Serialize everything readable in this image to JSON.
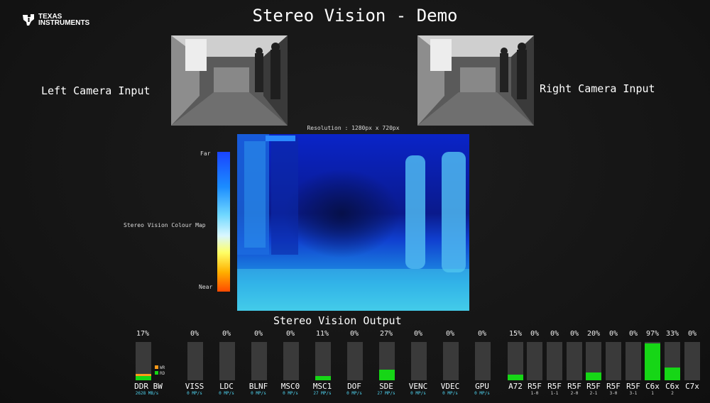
{
  "header": {
    "brand_line1": "TEXAS",
    "brand_line2": "INSTRUMENTS",
    "title": "Stereo Vision - Demo"
  },
  "cameras": {
    "left_label": "Left Camera Input",
    "right_label": "Right Camera Input"
  },
  "depth": {
    "resolution": "Resolution : 1280px x 720px",
    "colormap_label": "Stereo Vision Colour Map",
    "far_label": "Far",
    "near_label": "Near",
    "output_label": "Stereo Vision Output"
  },
  "ddr": {
    "percent": "17%",
    "name": "DDR BW",
    "rate": "2628 MB/s",
    "legend_wr": "WR",
    "legend_rd": "RD",
    "wr_color": "#ff9a1a",
    "rd_color": "#16d616",
    "wr_fill": 0.05,
    "rd_fill": 0.12
  },
  "meters": [
    {
      "name": "VISS",
      "percent": "0%",
      "rate": "0 MP/s",
      "fill": 0.0
    },
    {
      "name": "LDC",
      "percent": "0%",
      "rate": "0 MP/s",
      "fill": 0.0
    },
    {
      "name": "BLNF",
      "percent": "0%",
      "rate": "0 MP/s",
      "fill": 0.0
    },
    {
      "name": "MSC0",
      "percent": "0%",
      "rate": "0 MP/s",
      "fill": 0.0
    },
    {
      "name": "MSC1",
      "percent": "11%",
      "rate": "27 MP/s",
      "fill": 0.11
    },
    {
      "name": "DOF",
      "percent": "0%",
      "rate": "0 MP/s",
      "fill": 0.0
    },
    {
      "name": "SDE",
      "percent": "27%",
      "rate": "27 MP/s",
      "fill": 0.27
    },
    {
      "name": "VENC",
      "percent": "0%",
      "rate": "0 MP/s",
      "fill": 0.0
    },
    {
      "name": "VDEC",
      "percent": "0%",
      "rate": "0 MP/s",
      "fill": 0.0
    },
    {
      "name": "GPU",
      "percent": "0%",
      "rate": "0 MP/s",
      "fill": 0.0
    }
  ],
  "cpus": [
    {
      "name": "A72",
      "sub": "",
      "percent": "15%",
      "fill": 0.15
    },
    {
      "name": "R5F",
      "sub": "1-0",
      "percent": "0%",
      "fill": 0.0
    },
    {
      "name": "R5F",
      "sub": "1-1",
      "percent": "0%",
      "fill": 0.0
    },
    {
      "name": "R5F",
      "sub": "2-0",
      "percent": "0%",
      "fill": 0.0
    },
    {
      "name": "R5F",
      "sub": "2-1",
      "percent": "20%",
      "fill": 0.2
    },
    {
      "name": "R5F",
      "sub": "3-0",
      "percent": "0%",
      "fill": 0.0
    },
    {
      "name": "R5F",
      "sub": "3-1",
      "percent": "0%",
      "fill": 0.0
    },
    {
      "name": "C6x",
      "sub": "1",
      "percent": "97%",
      "fill": 0.97
    },
    {
      "name": "C6x",
      "sub": "2",
      "percent": "33%",
      "fill": 0.33
    },
    {
      "name": "C7x",
      "sub": "",
      "percent": "0%",
      "fill": 0.0
    }
  ]
}
